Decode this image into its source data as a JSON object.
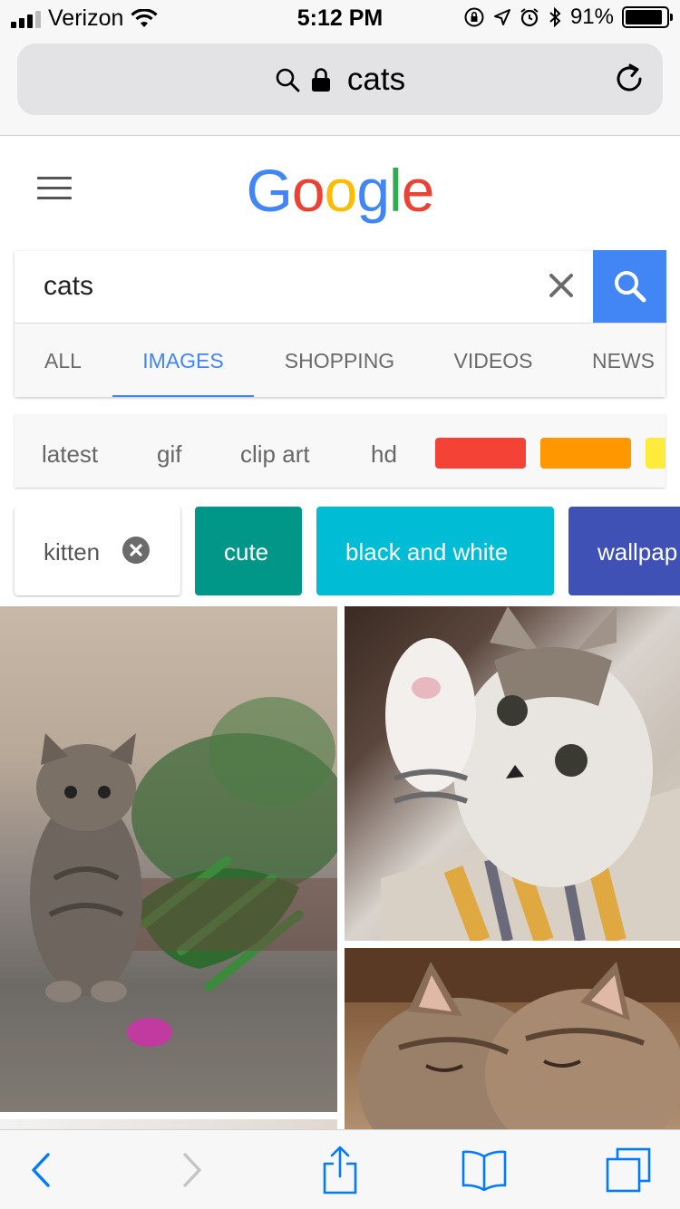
{
  "status_bar": {
    "carrier": "Verizon",
    "time": "5:12 PM",
    "battery_percent": "91%",
    "battery_level": 0.91,
    "icons": [
      "signal-icon",
      "wifi-icon",
      "orientation-lock-icon",
      "location-icon",
      "alarm-icon",
      "bluetooth-icon",
      "battery-icon"
    ]
  },
  "safari": {
    "address_query": "cats",
    "icons": [
      "search-icon",
      "lock-icon",
      "reload-icon"
    ]
  },
  "google": {
    "logo_letters": [
      {
        "char": "G",
        "color": "#4285f4"
      },
      {
        "char": "o",
        "color": "#ea4335"
      },
      {
        "char": "o",
        "color": "#fbbc05"
      },
      {
        "char": "g",
        "color": "#4285f4"
      },
      {
        "char": "l",
        "color": "#34a853"
      },
      {
        "char": "e",
        "color": "#ea4335"
      }
    ],
    "search": {
      "value": "cats",
      "accent_color": "#4285f4"
    },
    "tabs": [
      {
        "label": "ALL",
        "active": false
      },
      {
        "label": "IMAGES",
        "active": true
      },
      {
        "label": "SHOPPING",
        "active": false
      },
      {
        "label": "VIDEOS",
        "active": false
      },
      {
        "label": "NEWS",
        "active": false
      }
    ],
    "refinements": [
      "latest",
      "gif",
      "clip art",
      "hd"
    ],
    "color_swatches": [
      "#f44336",
      "#ff9800",
      "#ffeb3b"
    ],
    "tags": [
      {
        "label": "kitten",
        "selected": true,
        "color": "#ffffff"
      },
      {
        "label": "cute",
        "selected": false,
        "color": "#009688"
      },
      {
        "label": "black and white",
        "selected": false,
        "color": "#00bcd4"
      },
      {
        "label": "wallpap",
        "selected": false,
        "color": "#3f51b5"
      }
    ]
  },
  "toolbar": {
    "buttons": [
      "back-icon",
      "forward-icon",
      "share-icon",
      "bookmarks-icon",
      "tabs-icon"
    ]
  }
}
